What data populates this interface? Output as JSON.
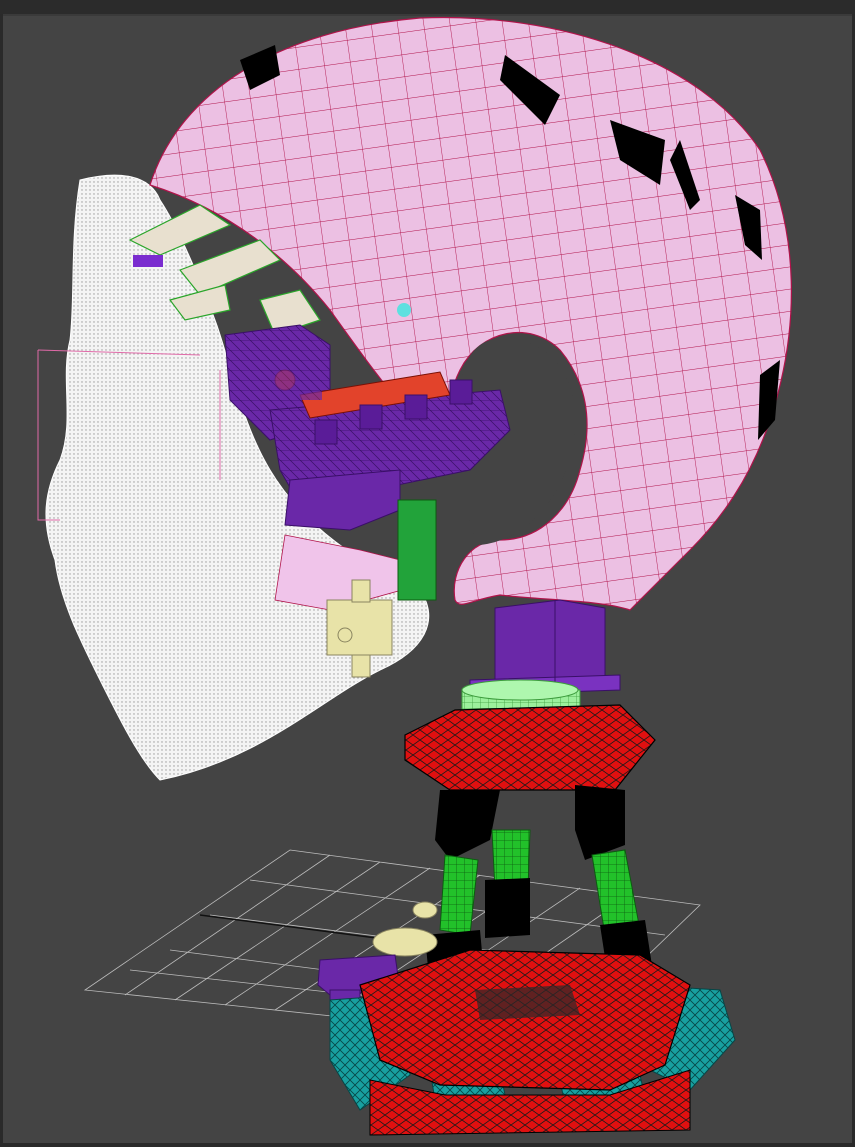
{
  "app": {
    "title": ""
  },
  "viewport": {
    "label": ""
  },
  "colors": {
    "background": "#444444",
    "skull": "#e9b7df",
    "wire": "#b0134a",
    "face_mesh": "#ffffff",
    "servo": "#6a28a8",
    "eye_rod": "#e2432b",
    "green_block": "#22a33a",
    "light_green": "#8fe88f",
    "base_red": "#e01010",
    "teal": "#1aa0a0",
    "yellow": "#e8e3a8",
    "grid": "#bcbcbc"
  },
  "objects": [
    {
      "name": "skull-shell",
      "color": "skull"
    },
    {
      "name": "face-mesh",
      "color": "face_mesh"
    },
    {
      "name": "eye-mechanism",
      "color": "servo"
    },
    {
      "name": "neck-servo",
      "color": "servo"
    },
    {
      "name": "stewart-platform",
      "color": "base_red"
    },
    {
      "name": "ground-grid",
      "color": "grid"
    }
  ]
}
